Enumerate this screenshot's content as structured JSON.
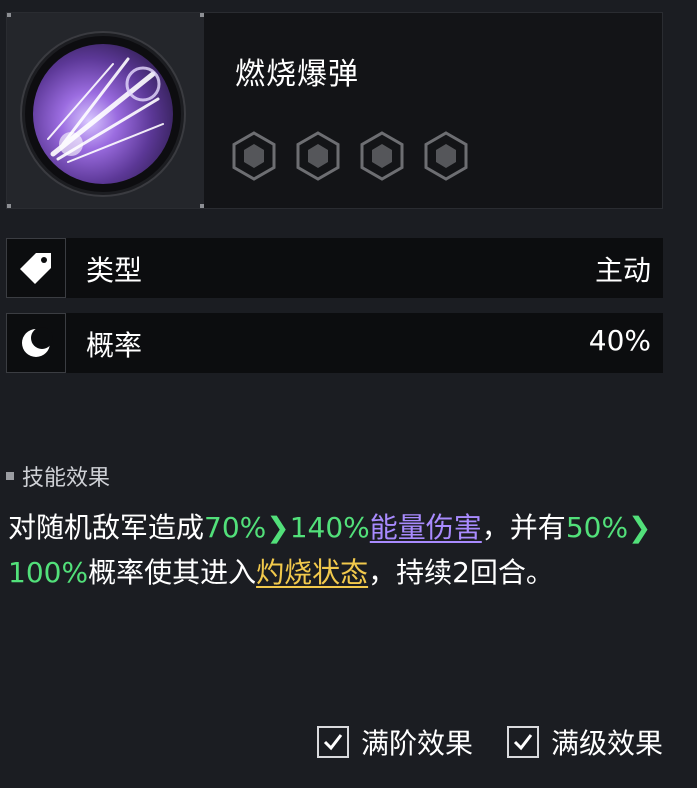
{
  "skill": {
    "name": "燃烧爆弹",
    "icon": "burning-bomb-icon",
    "star_count": 4
  },
  "attributes": [
    {
      "icon": "tag-icon",
      "label": "类型",
      "value": "主动"
    },
    {
      "icon": "crescent-moon-icon",
      "label": "概率",
      "value": "40%"
    }
  ],
  "effect": {
    "section_title": "技能效果",
    "text_1": "对随机敌军造成",
    "dmg_from": "70%",
    "dmg_to": "140%",
    "damage_type": "能量伤害",
    "text_2": "，并有",
    "chance_from": "50%",
    "chance_to": "100%",
    "text_3": "概率使其进入",
    "status": "灼烧状态",
    "text_4": "，持续2回合。"
  },
  "footer": {
    "max_stage": {
      "label": "满阶效果",
      "checked": true
    },
    "max_level": {
      "label": "满级效果",
      "checked": true
    }
  },
  "colors": {
    "highlight_green": "#52e07a",
    "energy_purple": "#a98bff",
    "burn_gold": "#f2c94c"
  }
}
